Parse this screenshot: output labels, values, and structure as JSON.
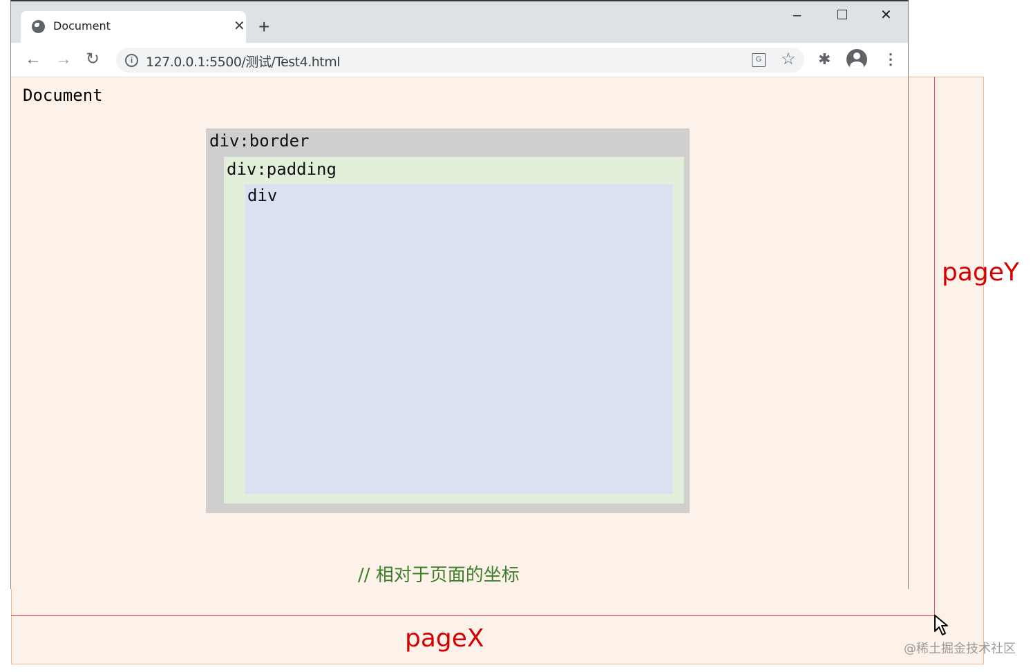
{
  "browser": {
    "tab_title": "Document",
    "tab_close": "✕",
    "new_tab": "+",
    "window_minimize": "–",
    "window_close": "✕",
    "url": "127.0.0.1:5500/测试/Test4.html",
    "info_icon": "i",
    "translate_icon": "G",
    "star_icon": "☆",
    "extensions_icon": "✱",
    "menu_icon": "⋮",
    "back_icon": "←",
    "forward_icon": "→",
    "reload_icon": "↻"
  },
  "page": {
    "document_label": "Document",
    "border_label": "div:border",
    "padding_label": "div:padding",
    "content_label": "div",
    "comment": "// 相对于页面的坐标"
  },
  "annotations": {
    "pagey_label": "pageY",
    "pagex_label": "pageX",
    "guide_color": "#e05050",
    "label_color": "#d40000",
    "watermark": "@稀土掘金技术社区"
  },
  "colors": {
    "page_background": "#fdf2ea",
    "border_box": "#d0cecf",
    "padding_box": "#e2efdb",
    "content_box": "#dae1f1",
    "comment_text": "#3e7e2a"
  }
}
